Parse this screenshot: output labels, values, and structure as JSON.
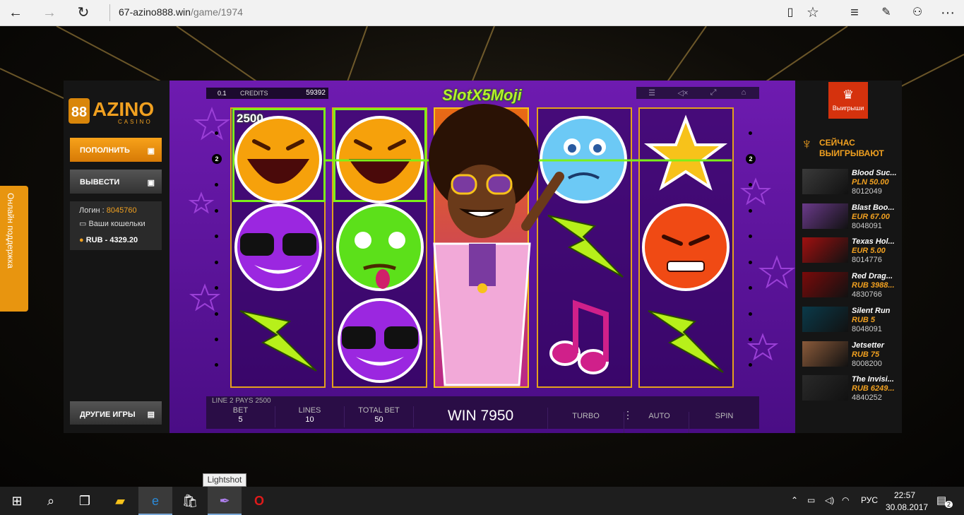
{
  "browser": {
    "url_host": "67-azino888.win",
    "url_path": "/game/1974"
  },
  "support": {
    "label": "Онлайн поддержка"
  },
  "sidebar": {
    "logo_text": "AZINO",
    "logo_sub": "CASINO",
    "deposit": "ПОПОЛНИТЬ",
    "withdraw": "ВЫВЕСТИ",
    "login_label": "Логин :",
    "login_value": "8045760",
    "wallets": "Ваши кошельки",
    "balance": "RUB - 4329.20",
    "other_games": "ДРУГИЕ ИГРЫ"
  },
  "slot": {
    "denom": "0.1",
    "credits_label": "CREDITS",
    "credits": "59392",
    "title": "SlotX5Moji",
    "win_badge": "2500",
    "line_marker": "2",
    "line_pays": "LINE 2 PAYS 2500",
    "bet_label": "BET",
    "bet": "5",
    "lines_label": "LINES",
    "lines": "10",
    "total_label": "TOTAL BET",
    "total": "50",
    "win": "WIN 7950",
    "turbo": "TURBO",
    "auto": "AUTO",
    "spin": "SPIN"
  },
  "right": {
    "wins_button": "Выигрыши",
    "now_line1": "СЕЙЧАС",
    "now_line2": "ВЫИГРЫВАЮТ",
    "winners": [
      {
        "game": "Blood Suc...",
        "amount": "PLN 50.00",
        "user": "8012049",
        "color": "#3a3a3a"
      },
      {
        "game": "Blast Boo...",
        "amount": "EUR 67.00",
        "user": "8048091",
        "color": "#6a3a8a"
      },
      {
        "game": "Texas Hol...",
        "amount": "EUR 5.00",
        "user": "8014776",
        "color": "#a01010"
      },
      {
        "game": "Red Drag...",
        "amount": "RUB 3988...",
        "user": "4830766",
        "color": "#7a0a0a"
      },
      {
        "game": "Silent Run",
        "amount": "RUB 5",
        "user": "8048091",
        "color": "#0a3a4a"
      },
      {
        "game": "Jetsetter",
        "amount": "RUB 75",
        "user": "8008200",
        "color": "#8a5a3a"
      },
      {
        "game": "The Invisi...",
        "amount": "RUB 6249...",
        "user": "4840252",
        "color": "#2a2a2a"
      }
    ]
  },
  "taskbar": {
    "tooltip": "Lightshot",
    "lang": "РУС",
    "time": "22:57",
    "date": "30.08.2017",
    "notif": "2"
  }
}
